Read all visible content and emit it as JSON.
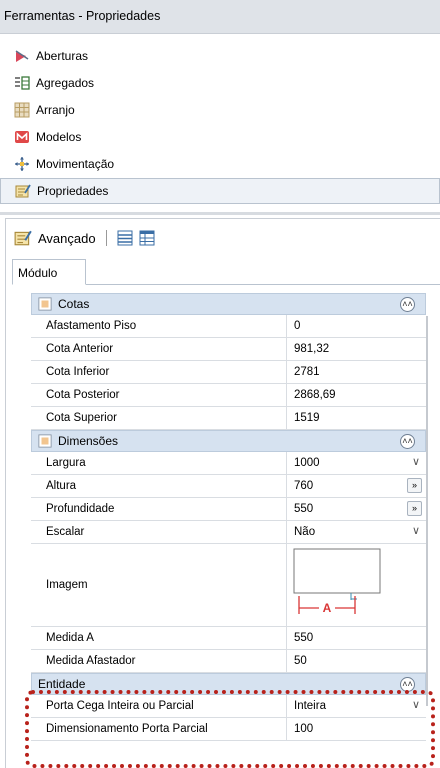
{
  "window": {
    "title": "Ferramentas - Propriedades"
  },
  "menu": {
    "items": [
      {
        "label": "Aberturas",
        "icon": "openings-icon"
      },
      {
        "label": "Agregados",
        "icon": "aggregates-icon"
      },
      {
        "label": "Arranjo",
        "icon": "arrangement-icon"
      },
      {
        "label": "Modelos",
        "icon": "models-icon"
      },
      {
        "label": "Movimentação",
        "icon": "move-icon"
      },
      {
        "label": "Propriedades",
        "icon": "properties-icon"
      }
    ],
    "selected": "Propriedades"
  },
  "toolbar": {
    "advanced_label": "Avançado"
  },
  "tabs": [
    {
      "label": "Módulo"
    }
  ],
  "grid": {
    "cotas": {
      "title": "Cotas",
      "rows": [
        {
          "name": "Afastamento Piso",
          "value": "0"
        },
        {
          "name": "Cota Anterior",
          "value": "981,32"
        },
        {
          "name": "Cota Inferior",
          "value": "2781"
        },
        {
          "name": "Cota Posterior",
          "value": "2868,69"
        },
        {
          "name": "Cota Superior",
          "value": "1519"
        }
      ]
    },
    "dimensoes": {
      "title": "Dimensões",
      "rows": [
        {
          "name": "Largura",
          "value": "1000"
        },
        {
          "name": "Altura",
          "value": "760"
        },
        {
          "name": "Profundidade",
          "value": "550"
        },
        {
          "name": "Escalar",
          "value": "Não"
        },
        {
          "name": "Imagem",
          "value": "",
          "image_label": "A"
        },
        {
          "name": "Medida A",
          "value": "550"
        },
        {
          "name": "Medida Afastador",
          "value": "50"
        }
      ]
    },
    "entidade": {
      "title": "Entidade",
      "rows": [
        {
          "name": "Porta Cega Inteira ou Parcial",
          "value": "Inteira"
        },
        {
          "name": "Dimensionamento Porta Parcial",
          "value": "100"
        }
      ]
    }
  },
  "colors": {
    "category_bg": "#d6e2f0",
    "highlight": "#b8221b",
    "selected_bg": "#eef2f7"
  }
}
